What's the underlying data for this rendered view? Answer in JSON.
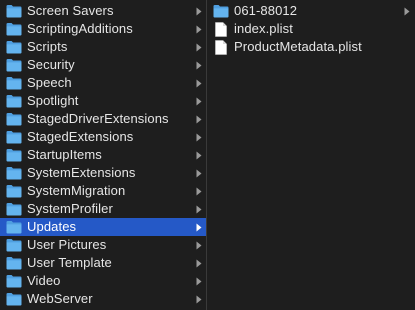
{
  "columns": {
    "left": {
      "items": [
        {
          "label": "Screen Savers",
          "icon": "folder-icon",
          "has_children": true,
          "selected": false
        },
        {
          "label": "ScriptingAdditions",
          "icon": "folder-icon",
          "has_children": true,
          "selected": false
        },
        {
          "label": "Scripts",
          "icon": "folder-icon",
          "has_children": true,
          "selected": false
        },
        {
          "label": "Security",
          "icon": "folder-icon",
          "has_children": true,
          "selected": false
        },
        {
          "label": "Speech",
          "icon": "folder-icon",
          "has_children": true,
          "selected": false
        },
        {
          "label": "Spotlight",
          "icon": "folder-icon",
          "has_children": true,
          "selected": false
        },
        {
          "label": "StagedDriverExtensions",
          "icon": "folder-icon",
          "has_children": true,
          "selected": false
        },
        {
          "label": "StagedExtensions",
          "icon": "folder-icon",
          "has_children": true,
          "selected": false
        },
        {
          "label": "StartupItems",
          "icon": "folder-icon",
          "has_children": true,
          "selected": false
        },
        {
          "label": "SystemExtensions",
          "icon": "folder-icon",
          "has_children": true,
          "selected": false
        },
        {
          "label": "SystemMigration",
          "icon": "folder-icon",
          "has_children": true,
          "selected": false
        },
        {
          "label": "SystemProfiler",
          "icon": "folder-icon",
          "has_children": true,
          "selected": false
        },
        {
          "label": "Updates",
          "icon": "folder-icon",
          "has_children": true,
          "selected": true
        },
        {
          "label": "User Pictures",
          "icon": "folder-icon",
          "has_children": true,
          "selected": false
        },
        {
          "label": "User Template",
          "icon": "folder-icon",
          "has_children": true,
          "selected": false
        },
        {
          "label": "Video",
          "icon": "folder-icon",
          "has_children": true,
          "selected": false
        },
        {
          "label": "WebServer",
          "icon": "folder-icon",
          "has_children": true,
          "selected": false
        }
      ]
    },
    "right": {
      "items": [
        {
          "label": "061-88012",
          "icon": "folder-icon",
          "has_children": true,
          "selected": false
        },
        {
          "label": "index.plist",
          "icon": "document-icon",
          "has_children": false,
          "selected": false
        },
        {
          "label": "ProductMetadata.plist",
          "icon": "document-icon",
          "has_children": false,
          "selected": false
        }
      ]
    }
  },
  "colors": {
    "background": "#1e1e1e",
    "selection": "#2559c7",
    "text": "#e6e6e6",
    "folder": "#5aa9e6",
    "chevron": "#9a9a9a"
  }
}
